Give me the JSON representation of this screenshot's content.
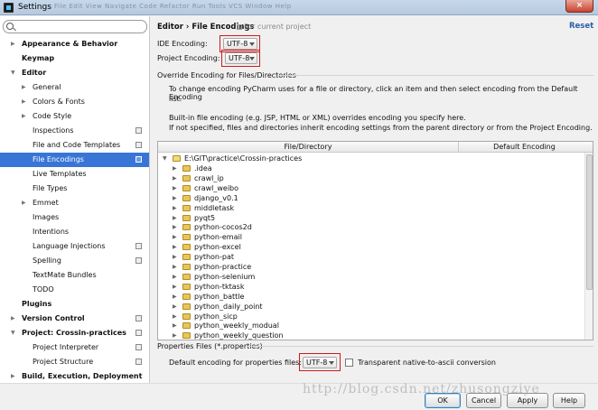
{
  "window": {
    "title": "Settings",
    "ghost_menu": "File  Edit  View  Navigate  Code  Refactor  Run  Tools  VCS  Window  Help",
    "close_label": "×"
  },
  "search": {
    "placeholder": "",
    "value": ""
  },
  "sidebar": {
    "items": [
      {
        "label": "Appearance & Behavior",
        "bold": true,
        "level": 0,
        "arrow": "▶"
      },
      {
        "label": "Keymap",
        "bold": true,
        "level": 0,
        "arrow": ""
      },
      {
        "label": "Editor",
        "bold": true,
        "level": 0,
        "arrow": "▼"
      },
      {
        "label": "General",
        "bold": false,
        "level": 1,
        "arrow": "▶"
      },
      {
        "label": "Colors & Fonts",
        "bold": false,
        "level": 1,
        "arrow": "▶"
      },
      {
        "label": "Code Style",
        "bold": false,
        "level": 1,
        "arrow": "▶"
      },
      {
        "label": "Inspections",
        "bold": false,
        "level": 1,
        "arrow": "",
        "proj": true
      },
      {
        "label": "File and Code Templates",
        "bold": false,
        "level": 1,
        "arrow": "",
        "proj": true
      },
      {
        "label": "File Encodings",
        "bold": false,
        "level": 1,
        "arrow": "",
        "proj": true,
        "selected": true
      },
      {
        "label": "Live Templates",
        "bold": false,
        "level": 1,
        "arrow": ""
      },
      {
        "label": "File Types",
        "bold": false,
        "level": 1,
        "arrow": ""
      },
      {
        "label": "Emmet",
        "bold": false,
        "level": 1,
        "arrow": "▶"
      },
      {
        "label": "Images",
        "bold": false,
        "level": 1,
        "arrow": ""
      },
      {
        "label": "Intentions",
        "bold": false,
        "level": 1,
        "arrow": ""
      },
      {
        "label": "Language Injections",
        "bold": false,
        "level": 1,
        "arrow": "",
        "proj": true
      },
      {
        "label": "Spelling",
        "bold": false,
        "level": 1,
        "arrow": "",
        "proj": true
      },
      {
        "label": "TextMate Bundles",
        "bold": false,
        "level": 1,
        "arrow": ""
      },
      {
        "label": "TODO",
        "bold": false,
        "level": 1,
        "arrow": ""
      },
      {
        "label": "Plugins",
        "bold": true,
        "level": 0,
        "arrow": ""
      },
      {
        "label": "Version Control",
        "bold": true,
        "level": 0,
        "arrow": "▶",
        "proj": true
      },
      {
        "label": "Project: Crossin-practices",
        "bold": true,
        "level": 0,
        "arrow": "▼",
        "proj": true
      },
      {
        "label": "Project Interpreter",
        "bold": false,
        "level": 1,
        "arrow": "",
        "proj": true
      },
      {
        "label": "Project Structure",
        "bold": false,
        "level": 1,
        "arrow": "",
        "proj": true
      },
      {
        "label": "Build, Execution, Deployment",
        "bold": true,
        "level": 0,
        "arrow": "▶"
      }
    ]
  },
  "header": {
    "crumb": "Editor › File Encodings",
    "sub": "For current project",
    "reset": "Reset"
  },
  "encoding": {
    "ide_label": "IDE Encoding:",
    "ide_value": "UTF-8",
    "project_label": "Project Encoding:",
    "project_value": "UTF-8"
  },
  "override": {
    "title": "Override Encoding for Files/Directories",
    "desc1": "To change encoding PyCharm uses for a file or directory, click an item and then select encoding from the Default Encoding",
    "desc1b": "list.",
    "desc2": "Built-in file encoding (e.g. JSP, HTML or XML) overrides encoding you specify here.",
    "desc3": "If not specified, files and directories inherit encoding settings from the parent directory or from the Project Encoding.",
    "col_file": "File/Directory",
    "col_enc": "Default Encoding",
    "root": "E:\\GIT\\practice\\Crossin-practices",
    "children": [
      ".idea",
      "crawl_ip",
      "crawl_weibo",
      "django_v0.1",
      "middletask",
      "pyqt5",
      "python-cocos2d",
      "python-email",
      "python-excel",
      "python-pat",
      "python-practice",
      "python-selenium",
      "python-tktask",
      "python_battle",
      "python_daily_point",
      "python_sicp",
      "python_weekly_modual",
      "python_weekly_question"
    ]
  },
  "props": {
    "title": "Properties Files (*.properties)",
    "label": "Default encoding for properties files:",
    "value": "UTF-8",
    "checkbox_label": "Transparent native-to-ascii conversion",
    "checked": false
  },
  "buttons": {
    "ok": "OK",
    "cancel": "Cancel",
    "apply": "Apply",
    "help": "Help"
  },
  "watermark": "http://blog.csdn.net/zhusongziye",
  "colors": {
    "selection": "#3875d7",
    "highlight_box": "#d11a1a",
    "link": "#2a5fa8"
  }
}
